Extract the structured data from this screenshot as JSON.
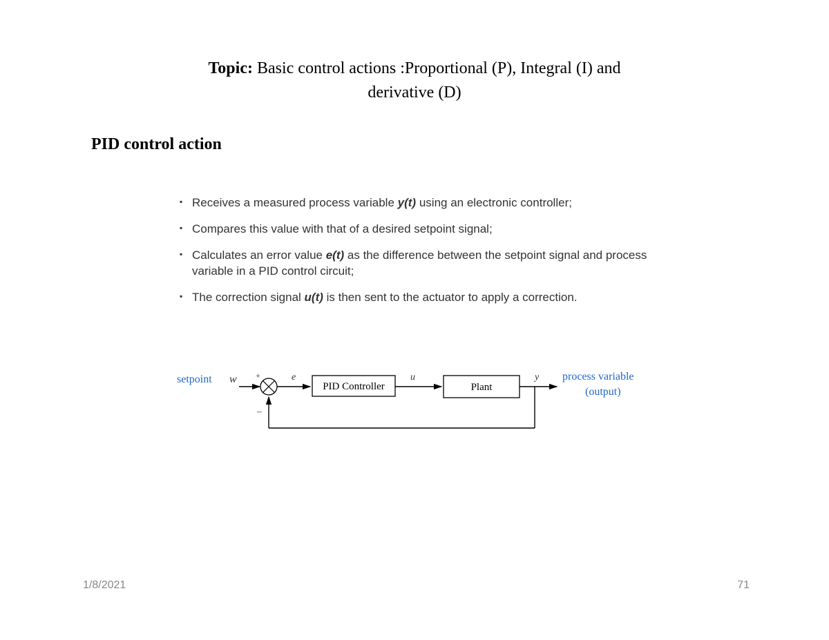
{
  "topic_label": "Topic:",
  "topic_text": "Basic control actions :Proportional (P), Integral (I)  and derivative (D)",
  "section_title": "PID control action",
  "bullets": {
    "b1_pre": "Receives a measured process variable ",
    "b1_var": "y(t)",
    "b1_post": " using an electronic controller;",
    "b2": "Compares this value with that of a desired setpoint signal;",
    "b3_pre": "Calculates an error value ",
    "b3_var": "e(t)",
    "b3_post": " as the difference between the setpoint signal and process variable in a PID control circuit;",
    "b4_pre": "The correction signal ",
    "b4_var": "u(t)",
    "b4_post": " is then sent to the actuator to apply a correction."
  },
  "diagram": {
    "setpoint_label": "setpoint",
    "w": "w",
    "plus": "+",
    "minus": "–",
    "e": "e",
    "controller": "PID Controller",
    "u": "u",
    "plant": "Plant",
    "y": "y",
    "output_label_1": "process variable",
    "output_label_2": "(output)"
  },
  "footer": {
    "date": "1/8/2021",
    "page": "71"
  }
}
